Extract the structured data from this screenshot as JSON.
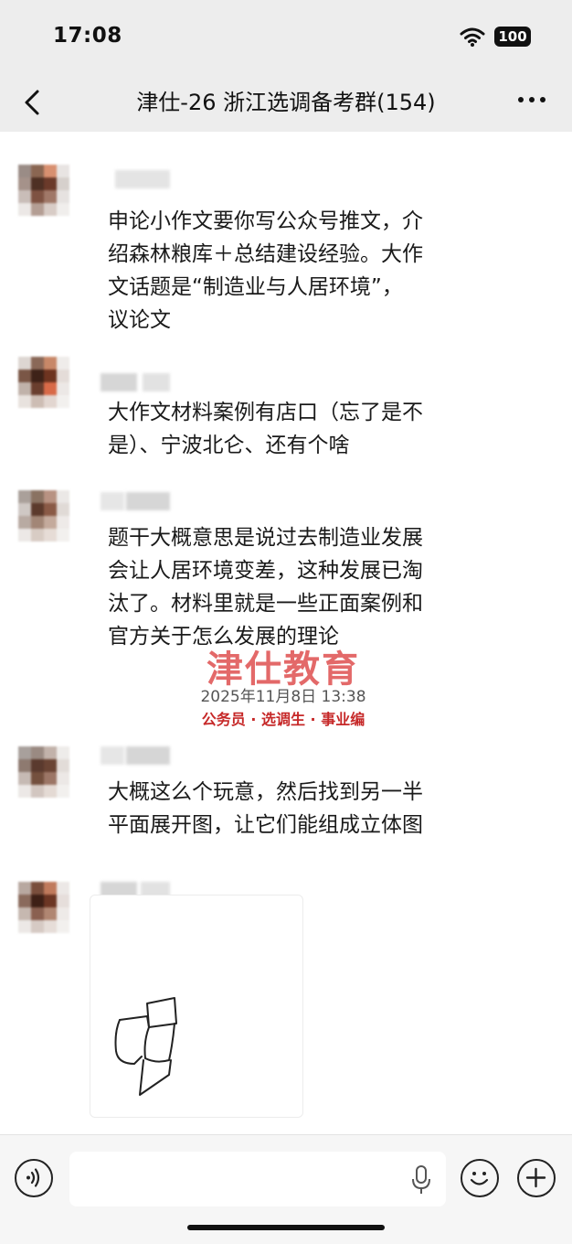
{
  "status": {
    "time": "17:08",
    "battery": "100"
  },
  "nav": {
    "title": "津仕-26 浙江选调备考群(154)"
  },
  "messages": [
    {
      "text_lines": [
        "申论小作文要你写公众号推文，介",
        "绍森林粮库＋总结建设经验。大作",
        "文话题是“制造业与人居环境”，",
        "议论文"
      ]
    },
    {
      "text_lines": [
        "大作文材料案例有店口（忘了是不",
        "是）、宁波北仑、还有个啥"
      ]
    },
    {
      "text_lines": [
        "题干大概意思是说过去制造业发展",
        "会让人居环境变差，这种发展已淘",
        "汰了。材料里就是一些正面案例和",
        "官方关于怎么发展的理论"
      ]
    },
    {
      "text_lines": [
        "大概这么个玩意，然后找到另一半",
        "平面展开图，让它们能组成立体图"
      ]
    }
  ],
  "watermark": {
    "brand": "津仕教育",
    "timestamp": "2025年11月8日 13:38",
    "sub": "公务员 · 选调生 · 事业编"
  },
  "icons": {
    "back": "chevron-left-icon",
    "more": "more-dots-icon",
    "voice": "voice-icon",
    "mic": "mic-icon",
    "emoji": "emoji-icon",
    "add": "add-icon",
    "wifi": "wifi-icon"
  },
  "colors": {
    "watermark_red": "#d93030",
    "bar_bg": "#ededed"
  }
}
